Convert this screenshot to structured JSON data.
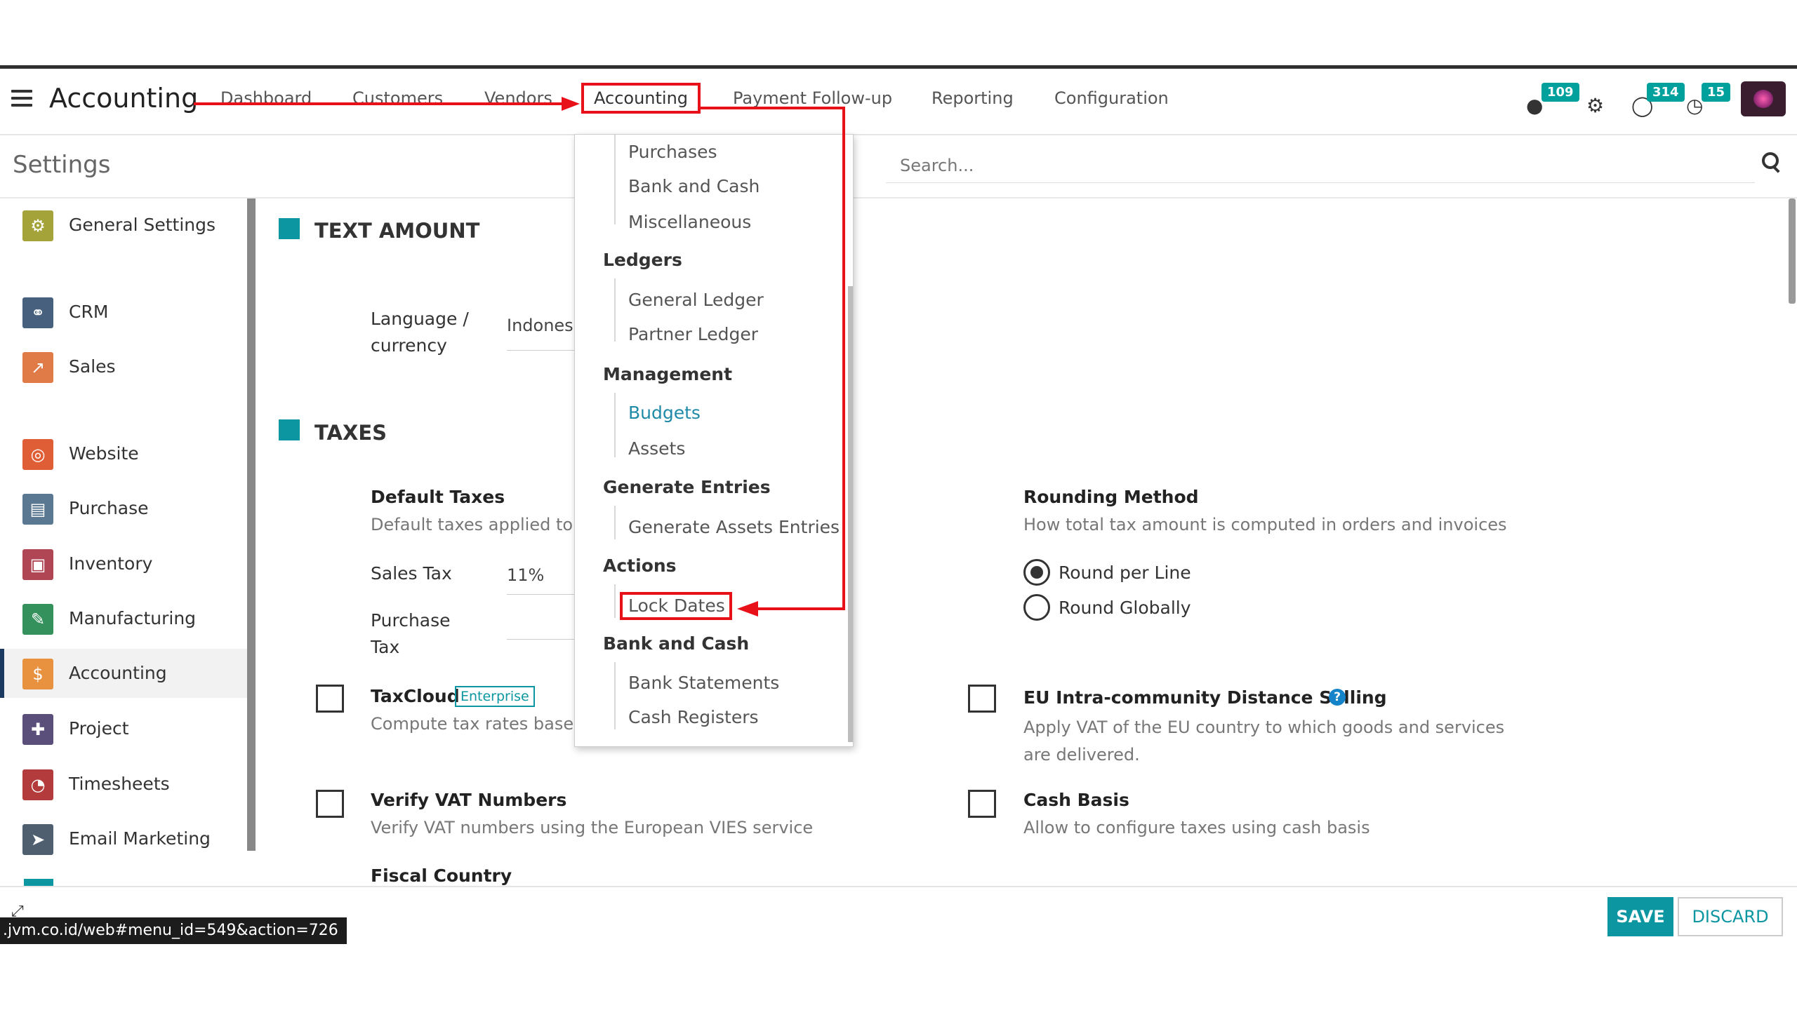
{
  "app": {
    "title": "Accounting"
  },
  "navbar": {
    "menu": [
      "Dashboard",
      "Customers",
      "Vendors",
      "Accounting",
      "Payment Follow-up",
      "Reporting",
      "Configuration"
    ],
    "badges": {
      "messages": "109",
      "activity": "314",
      "clock": "15"
    },
    "icons": [
      "hamburger-icon",
      "chat-icon",
      "gear-icon",
      "whatsapp-icon",
      "clock-icon",
      "user-avatar"
    ]
  },
  "control_panel": {
    "breadcrumb": "Settings",
    "search_placeholder": "Search..."
  },
  "sidebar": {
    "items": [
      {
        "label": "General Settings",
        "icon": "gear-icon",
        "color": "#a4a33a"
      },
      {
        "label": "CRM",
        "icon": "handshake-icon",
        "color": "#47607e"
      },
      {
        "label": "Sales",
        "icon": "chart-icon",
        "color": "#e07a46"
      },
      {
        "label": "Website",
        "icon": "globe-icon",
        "color": "#e05e36"
      },
      {
        "label": "Purchase",
        "icon": "card-icon",
        "color": "#5a7891"
      },
      {
        "label": "Inventory",
        "icon": "box-icon",
        "color": "#b04553"
      },
      {
        "label": "Manufacturing",
        "icon": "wrench-icon",
        "color": "#34915b"
      },
      {
        "label": "Accounting",
        "icon": "dollar-icon",
        "color": "#e8913e"
      },
      {
        "label": "Project",
        "icon": "puzzle-icon",
        "color": "#5a4f7b"
      },
      {
        "label": "Timesheets",
        "icon": "stopwatch-icon",
        "color": "#b33b3b"
      },
      {
        "label": "Email Marketing",
        "icon": "paper-plane-icon",
        "color": "#4f5f6f"
      }
    ]
  },
  "main": {
    "text_amount": {
      "title": "TEXT AMOUNT",
      "language_label": "Language / currency",
      "language_value": "Indones"
    },
    "taxes": {
      "title": "TAXES",
      "default_taxes_title": "Default Taxes",
      "default_taxes_desc": "Default taxes applied to l",
      "sales_tax_label": "Sales Tax",
      "sales_tax_value": "11%",
      "purchase_tax_label": "Purchase Tax",
      "rounding_title": "Rounding Method",
      "rounding_desc": "How total tax amount is computed in orders and invoices",
      "rounding_options": [
        "Round per Line",
        "Round Globally"
      ],
      "rounding_selected": "Round per Line",
      "taxcloud_title": "TaxCloud",
      "taxcloud_badge": "Enterprise",
      "taxcloud_desc": "Compute tax rates based",
      "eu_title": "EU Intra-community Distance Selling",
      "eu_desc": "Apply VAT of the EU country to which goods and services are delivered.",
      "verify_vat_title": "Verify VAT Numbers",
      "verify_vat_desc": "Verify VAT numbers using the European VIES service",
      "cash_basis_title": "Cash Basis",
      "cash_basis_desc": "Allow to configure taxes using cash basis",
      "fiscal_country_title": "Fiscal Country"
    }
  },
  "dropdown": {
    "items_top": [
      "Purchases",
      "Bank and Cash",
      "Miscellaneous"
    ],
    "ledgers_header": "Ledgers",
    "ledgers": [
      "General Ledger",
      "Partner Ledger"
    ],
    "management_header": "Management",
    "management": [
      "Budgets",
      "Assets"
    ],
    "generate_header": "Generate Entries",
    "generate": [
      "Generate Assets Entries"
    ],
    "actions_header": "Actions",
    "actions": [
      "Lock Dates"
    ],
    "bank_header": "Bank and Cash",
    "bank": [
      "Bank Statements",
      "Cash Registers"
    ]
  },
  "footer": {
    "save_label": "SAVE",
    "discard_label": "DISCARD",
    "status_url": ".jvm.co.id/web#menu_id=549&action=726"
  },
  "annotations": {
    "accent_color": "#e8111a"
  },
  "colors": {
    "primary": "#0c96a1",
    "dark_text": "#333333",
    "muted_text": "#777777",
    "highlight_link": "#1f8aa8"
  }
}
